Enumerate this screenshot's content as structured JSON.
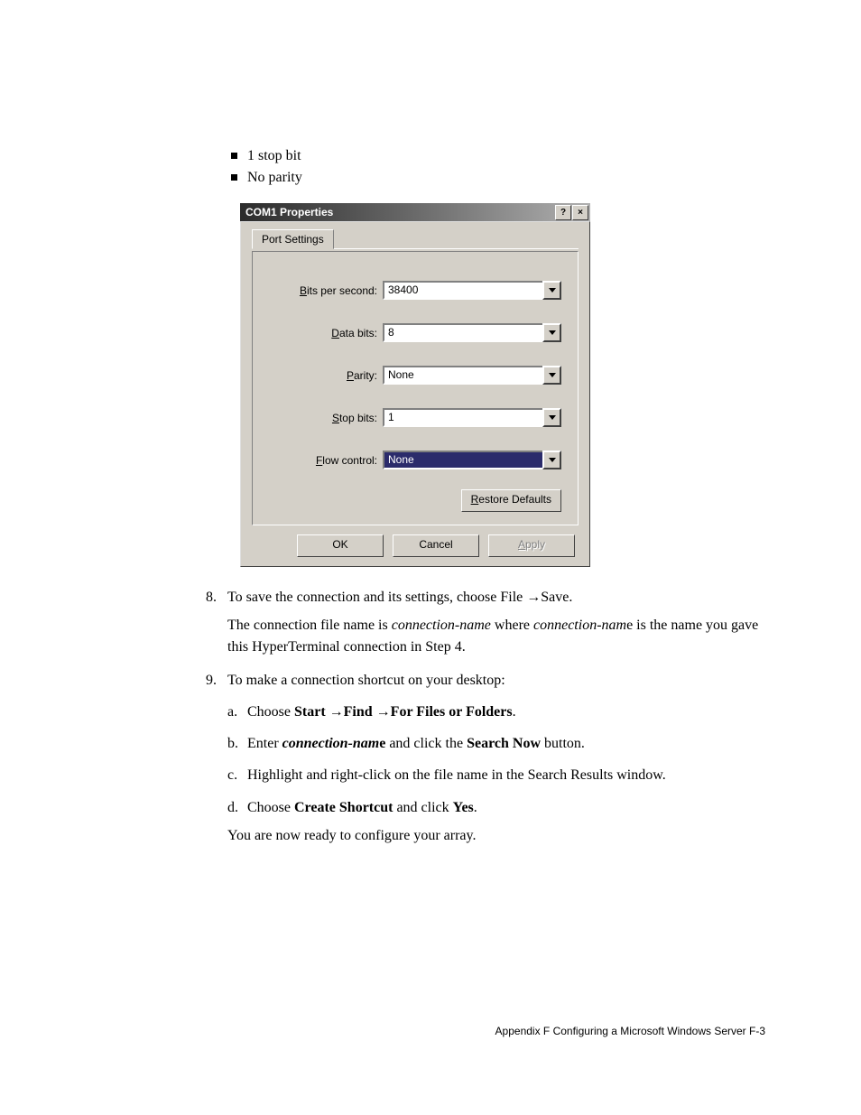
{
  "bullets": [
    "1 stop bit",
    "No parity"
  ],
  "dialog": {
    "title": "COM1 Properties",
    "help": "?",
    "close": "×",
    "tab": "Port Settings",
    "fields": {
      "bps": {
        "label_pre": "B",
        "label_rest": "its per second:",
        "value": "38400"
      },
      "data": {
        "label_pre": "D",
        "label_rest": "ata bits:",
        "value": "8"
      },
      "parity": {
        "label_pre": "P",
        "label_rest": "arity:",
        "value": "None"
      },
      "stop": {
        "label_pre": "S",
        "label_rest": "top bits:",
        "value": "1"
      },
      "flow": {
        "label_pre": "F",
        "label_rest": "low control:",
        "value": "None"
      }
    },
    "restore_pre": "R",
    "restore_rest": "estore Defaults",
    "ok": "OK",
    "cancel": "Cancel",
    "apply_pre": "A",
    "apply_rest": "pply"
  },
  "step8": {
    "num": "8.",
    "text_a": "To save the connection and its settings, choose File ",
    "arrow": "→",
    "text_b": "Save.",
    "para_a": "The connection file name is ",
    "para_b": "connection-name",
    "para_c": " where ",
    "para_d": "connection-nam",
    "para_e": "e is the name you gave this HyperTerminal connection in Step 4."
  },
  "step9": {
    "num": "9.",
    "intro": "To make a connection shortcut on your desktop:",
    "a": {
      "lett": "a.",
      "t1": "Choose ",
      "t2": "Start ",
      "arrow": "→",
      "t3": "Find ",
      "t4": "For Files or Folders",
      "t5": "."
    },
    "b": {
      "lett": "b.",
      "t1": "Enter ",
      "t2": "connection-nam",
      "t3": "e",
      "t4": " and click the ",
      "t5": "Search Now",
      "t6": " button."
    },
    "c": {
      "lett": "c.",
      "t1": "Highlight and right-click on the file name in the Search Results window."
    },
    "d": {
      "lett": "d.",
      "t1": "Choose ",
      "t2": "Create Shortcut",
      "t3": " and click ",
      "t4": "Yes",
      "t5": "."
    },
    "outro": "You are now ready to configure your array."
  },
  "footer": "Appendix F    Configuring a Microsoft Windows Server F-3"
}
